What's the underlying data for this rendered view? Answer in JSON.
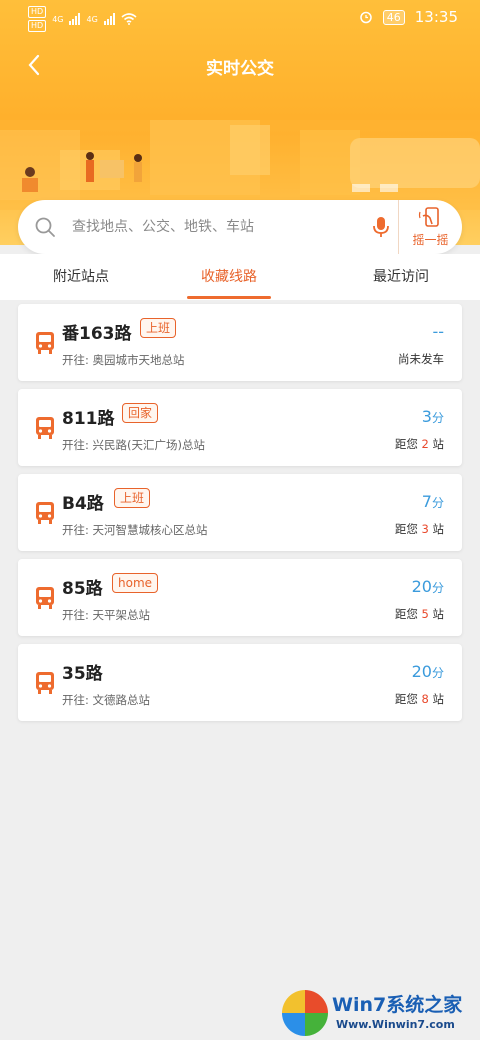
{
  "status_bar": {
    "left_badges": [
      "HD",
      "HD"
    ],
    "network": [
      "4G",
      "4G"
    ],
    "battery": "46",
    "time": "13:35"
  },
  "header": {
    "title": "实时公交",
    "back_icon": "chevron-left-icon"
  },
  "search": {
    "placeholder": "查找地点、公交、地铁、车站",
    "shake_label": "摇一摇"
  },
  "tabs": [
    {
      "label": "附近站点",
      "active": false
    },
    {
      "label": "收藏线路",
      "active": true
    },
    {
      "label": "最近访问",
      "active": false
    }
  ],
  "routes": [
    {
      "name": "番163路",
      "tag": "上班",
      "destination": "开往: 奥园城市天地总站",
      "eta": "--",
      "eta_unit": "",
      "status": "尚未发车",
      "stops_prefix": "",
      "stops": "",
      "stops_suffix": ""
    },
    {
      "name": "811路",
      "tag": "回家",
      "destination": "开往: 兴民路(天汇广场)总站",
      "eta": "3",
      "eta_unit": "分",
      "status": "",
      "stops_prefix": "距您",
      "stops": "2",
      "stops_suffix": "站"
    },
    {
      "name": "B4路",
      "tag": "上班",
      "destination": "开往: 天河智慧城核心区总站",
      "eta": "7",
      "eta_unit": "分",
      "status": "",
      "stops_prefix": "距您",
      "stops": "3",
      "stops_suffix": "站"
    },
    {
      "name": "85路",
      "tag": "home",
      "destination": "开往: 天平架总站",
      "eta": "20",
      "eta_unit": "分",
      "status": "",
      "stops_prefix": "距您",
      "stops": "5",
      "stops_suffix": "站"
    },
    {
      "name": "35路",
      "tag": "",
      "destination": "开往: 文德路总站",
      "eta": "20",
      "eta_unit": "分",
      "status": "",
      "stops_prefix": "距您",
      "stops": "8",
      "stops_suffix": "站"
    }
  ],
  "watermark": {
    "title": "Win7系统之家",
    "url": "Www.Winwin7.com"
  },
  "colors": {
    "accent": "#e8632b",
    "eta_blue": "#3b9bdc",
    "header_orange": "#ffae2a"
  }
}
